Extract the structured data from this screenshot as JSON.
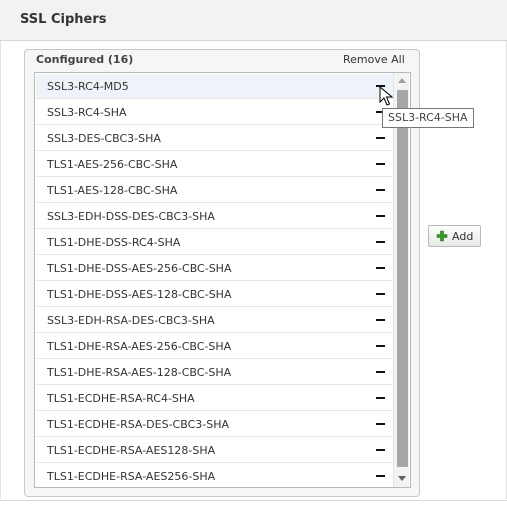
{
  "header": {
    "title": "SSL Ciphers"
  },
  "configured": {
    "title": "Configured (16)",
    "remove_all_label": "Remove All",
    "remove_icon": "minus-icon",
    "items": [
      "SSL3-RC4-MD5",
      "SSL3-RC4-SHA",
      "SSL3-DES-CBC3-SHA",
      "TLS1-AES-256-CBC-SHA",
      "TLS1-AES-128-CBC-SHA",
      "SSL3-EDH-DSS-DES-CBC3-SHA",
      "TLS1-DHE-DSS-RC4-SHA",
      "TLS1-DHE-DSS-AES-256-CBC-SHA",
      "TLS1-DHE-DSS-AES-128-CBC-SHA",
      "SSL3-EDH-RSA-DES-CBC3-SHA",
      "TLS1-DHE-RSA-AES-256-CBC-SHA",
      "TLS1-DHE-RSA-AES-128-CBC-SHA",
      "TLS1-ECDHE-RSA-RC4-SHA",
      "TLS1-ECDHE-RSA-DES-CBC3-SHA",
      "TLS1-ECDHE-RSA-AES128-SHA",
      "TLS1-ECDHE-RSA-AES256-SHA"
    ],
    "hovered_index": 0
  },
  "tooltip": {
    "text": "SSL3-RC4-SHA"
  },
  "add_button": {
    "label": "Add",
    "icon": "plus-icon",
    "icon_color": "#3a9a2e"
  },
  "colors": {
    "header_bg": "#f2f2f2",
    "selected_row_bg": "#eef3f9",
    "scroll_thumb": "#a6a6a6"
  }
}
